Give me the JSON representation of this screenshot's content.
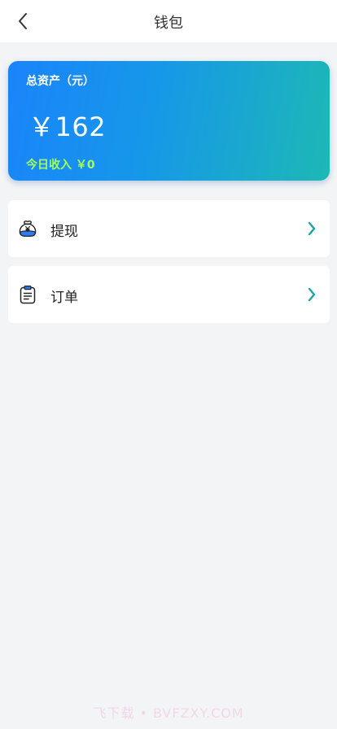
{
  "header": {
    "title": "钱包"
  },
  "asset_card": {
    "label": "总资产（元）",
    "amount": "￥162",
    "today_income": "今日收入 ￥0"
  },
  "menu": [
    {
      "label": "提现",
      "icon": "money-bag-icon"
    },
    {
      "label": "订单",
      "icon": "clipboard-icon"
    }
  ],
  "watermark": "飞下载 • BVFZXY.COM",
  "colors": {
    "card_gradient_start": "#1a84fb",
    "card_gradient_end": "#1db8b5",
    "income_text": "#a4ff5a",
    "chevron": "#1aa6a6",
    "background": "#f3f4f6"
  }
}
